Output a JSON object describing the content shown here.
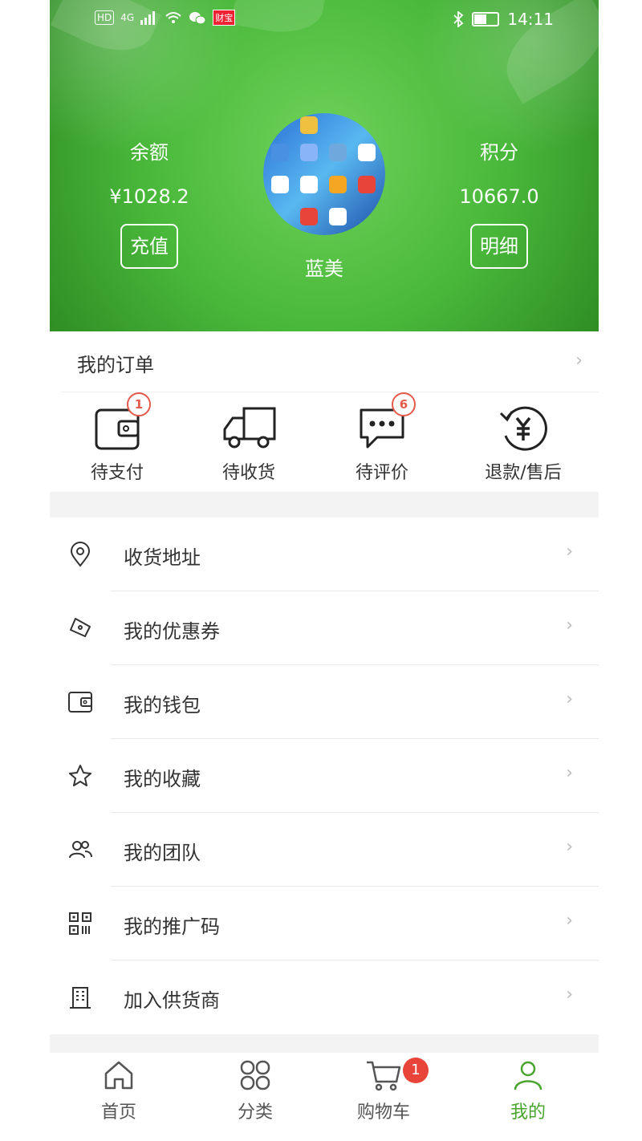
{
  "status_bar": {
    "network": "4G",
    "left_tag": "HD",
    "app_tag": "财宝",
    "time": "14:11"
  },
  "header": {
    "balance": {
      "label": "余额",
      "value": "¥1028.2",
      "button": "充值"
    },
    "points": {
      "label": "积分",
      "value": "10667.0",
      "button": "明细"
    },
    "username": "蓝美"
  },
  "orders": {
    "title": "我的订单",
    "items": [
      {
        "label": "待支付",
        "icon": "wallet-icon",
        "badge": "1"
      },
      {
        "label": "待收货",
        "icon": "truck-icon",
        "badge": ""
      },
      {
        "label": "待评价",
        "icon": "chat-icon",
        "badge": "6"
      },
      {
        "label": "退款/售后",
        "icon": "refund-yen-icon",
        "badge": ""
      }
    ]
  },
  "menu": [
    {
      "label": "收货地址",
      "icon": "location-pin-icon"
    },
    {
      "label": "我的优惠券",
      "icon": "coupon-icon"
    },
    {
      "label": "我的钱包",
      "icon": "wallet-icon"
    },
    {
      "label": "我的收藏",
      "icon": "star-icon"
    },
    {
      "label": "我的团队",
      "icon": "team-icon"
    },
    {
      "label": "我的推广码",
      "icon": "qr-code-icon"
    },
    {
      "label": "加入供货商",
      "icon": "building-icon"
    }
  ],
  "tabbar": {
    "items": [
      {
        "label": "首页",
        "icon": "home-icon"
      },
      {
        "label": "分类",
        "icon": "category-icon"
      },
      {
        "label": "购物车",
        "icon": "cart-icon",
        "badge": "1"
      },
      {
        "label": "我的",
        "icon": "user-icon",
        "active": true
      }
    ]
  },
  "colors": {
    "accent": "#49a52e",
    "badge_red": "#e8443a",
    "header_green": "#49b83a"
  }
}
